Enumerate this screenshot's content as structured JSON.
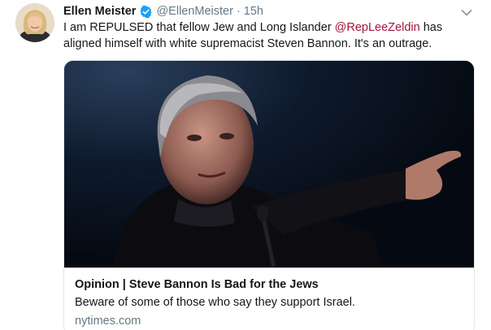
{
  "tweet": {
    "author": {
      "name": "Ellen Meister",
      "handle": "@EllenMeister",
      "verified": true,
      "avatar_icon": "avatar-photo-icon"
    },
    "separator": "·",
    "time": "15h",
    "text_before": "I am REPULSED that fellow Jew and Long Islander ",
    "mention": "@RepLeeZeldin",
    "text_after": " has aligned himself with white supremacist Steven Bannon. It's an outrage.",
    "menu_icon": "chevron-down-icon"
  },
  "card": {
    "title": "Opinion | Steve Bannon Is Bad for the Jews",
    "description": "Beware of some of those who say they support Israel.",
    "domain": "nytimes.com"
  },
  "colors": {
    "mention": "#a4143c",
    "verified": "#1da1f2",
    "secondary_text": "#657786"
  }
}
